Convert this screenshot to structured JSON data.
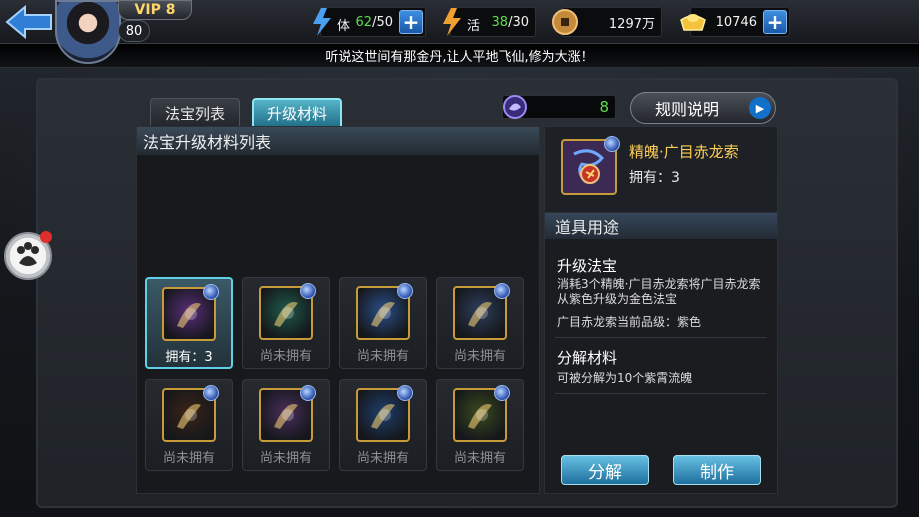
{
  "ticker": "听说这世间有那金丹,让人平地飞仙,修为大涨！",
  "player": {
    "vip": "VIP 8",
    "level": "80"
  },
  "resources": {
    "stamina": {
      "current": "62",
      "max": " /50",
      "icon_text": "体"
    },
    "energy": {
      "current": "38",
      "max": " /30",
      "icon_text": "活"
    },
    "copper": {
      "value": "1297万"
    },
    "gold": {
      "value": "10746"
    }
  },
  "tabs": {
    "treasure_list": "法宝列表",
    "upgrade_materials": "升级材料"
  },
  "gem_count": "8",
  "rules_button": "规则说明",
  "list_title": "法宝升级材料列表",
  "items": [
    {
      "label": "拥有：3",
      "owned": true,
      "hue": "#5a2e7a",
      "icon": "rope-whip-icon"
    },
    {
      "label": "尚未拥有",
      "owned": false,
      "hue": "#1f5a4a",
      "icon": "crystal-icon"
    },
    {
      "label": "尚未拥有",
      "owned": false,
      "hue": "#2a4f8a",
      "icon": "gourd-icon"
    },
    {
      "label": "尚未拥有",
      "owned": false,
      "hue": "#2d3e5c",
      "icon": "whisk-icon"
    },
    {
      "label": "尚未拥有",
      "owned": false,
      "hue": "#3a2418",
      "icon": "sword-icon"
    },
    {
      "label": "尚未拥有",
      "owned": false,
      "hue": "#4a2e5c",
      "icon": "staff-icon"
    },
    {
      "label": "尚未拥有",
      "owned": false,
      "hue": "#1e3f6e",
      "icon": "scythe-icon"
    },
    {
      "label": "尚未拥有",
      "owned": false,
      "hue": "#3a4a1e",
      "icon": "feather-fan-icon"
    }
  ],
  "detail": {
    "name": "精魄·广目赤龙索",
    "owned": "拥有：3",
    "usage_title": "道具用途",
    "upgrade_head": "升级法宝",
    "upgrade_text": "消耗3个精魄·广目赤龙索将广目赤龙索从紫色升级为金色法宝",
    "quality_text": "广目赤龙索当前品级：紫色",
    "decompose_head": "分解材料",
    "decompose_text": "可被分解为10个紫霄流魄",
    "decompose_button": "分解",
    "craft_button": "制作"
  },
  "colors": {
    "accent": "#5ed0e8",
    "gold_text": "#ffcf57",
    "green_value": "#5fdc4f",
    "button_blue": "#1e6f9e"
  }
}
